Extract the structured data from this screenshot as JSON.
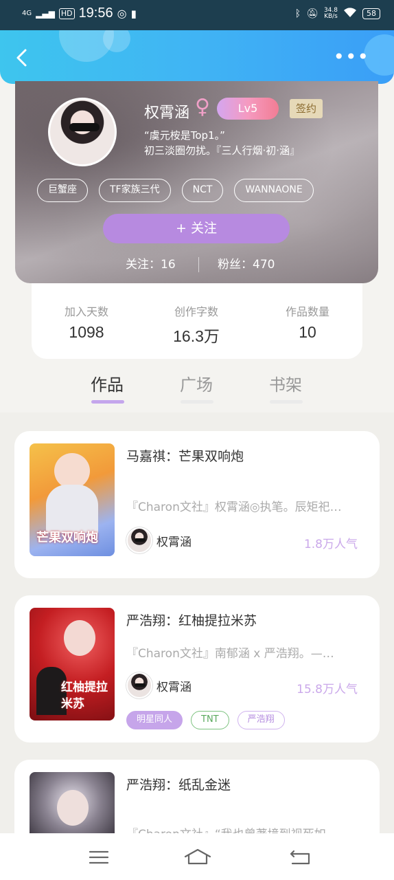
{
  "status_bar": {
    "signal": "4G",
    "hd": "HD",
    "time": "19:56",
    "net_speed": "34.8",
    "net_unit": "KB/s",
    "battery": "58"
  },
  "profile": {
    "name": "权霄涵",
    "gender_symbol": "♀",
    "level": "Lv5",
    "signed_badge": "签约",
    "bio_line1": "“虞元桉是Top1。”",
    "bio_line2": "初三淡圈勿扰。『三人行烟·初·涵』",
    "tags": [
      "巨蟹座",
      "TF家族三代",
      "NCT",
      "WANNAONE"
    ],
    "follow_button": "+ 关注",
    "following_label": "关注：16",
    "fans_label": "粉丝：470"
  },
  "stats": [
    {
      "label": "加入天数",
      "value": "1098"
    },
    {
      "label": "创作字数",
      "value": "16.3万"
    },
    {
      "label": "作品数量",
      "value": "10"
    }
  ],
  "tabs": [
    {
      "label": "作品",
      "active": true
    },
    {
      "label": "广场",
      "active": false
    },
    {
      "label": "书架",
      "active": false
    }
  ],
  "works": [
    {
      "title": "马嘉祺：芒果双响炮",
      "desc": "『Charon文社』权霄涵◎执笔。辰矩祀…",
      "author": "权霄涵",
      "popularity": "1.8万人气",
      "cover_text": "芒果双响炮",
      "tags": []
    },
    {
      "title": "严浩翔：红柚提拉米苏",
      "desc": "『Charon文社』南郁涵 x 严浩翔。—…",
      "author": "权霄涵",
      "popularity": "15.8万人气",
      "cover_text": "红柚提拉米苏",
      "tags": [
        "明星同人",
        "TNT",
        "严浩翔"
      ]
    },
    {
      "title": "严浩翔：纸乱金迷",
      "desc": "『Charon文社』“我也曾著境到视死如…",
      "author": "",
      "popularity": "",
      "cover_text": "",
      "tags": []
    }
  ],
  "colors": {
    "header_gradient_start": "#3ec5ee",
    "header_gradient_end": "#3a9ef7",
    "accent_purple": "#b78ae0",
    "popularity_purple": "#caa8ea",
    "signed_badge_bg": "#e6d9b8"
  },
  "icons": {
    "back": "chevron-left-icon",
    "more": "more-dots-icon",
    "nav_menu": "menu-icon",
    "nav_home": "home-icon",
    "nav_back": "back-icon"
  }
}
